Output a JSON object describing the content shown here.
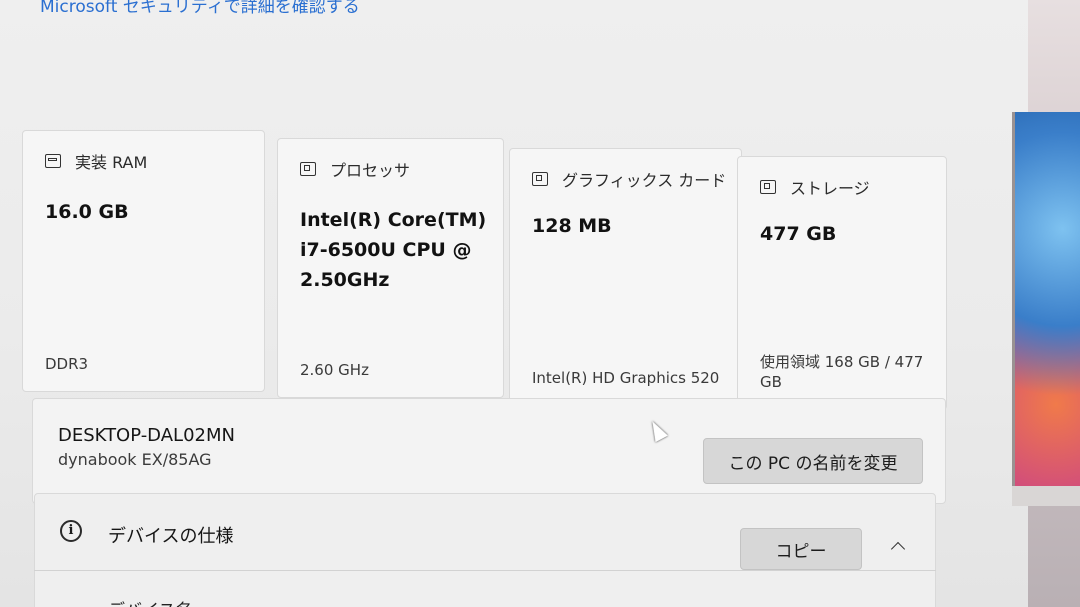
{
  "header": {
    "link_text": "Microsoft セキュリティで詳細を確認する"
  },
  "cards": [
    {
      "id": "ram",
      "title": "実装 RAM",
      "icon": "memory-icon",
      "value": "16.0 GB",
      "sub": "DDR3"
    },
    {
      "id": "cpu",
      "title": "プロセッサ",
      "icon": "processor-icon",
      "value_lines": [
        "Intel(R) Core(TM)",
        "i7-6500U CPU @",
        "2.50GHz"
      ],
      "sub": "2.60 GHz"
    },
    {
      "id": "gpu",
      "title": "グラフィックス カード",
      "icon": "graphics-card-icon",
      "value": "128 MB",
      "sub": "Intel(R) HD Graphics 520"
    },
    {
      "id": "storage",
      "title": "ストレージ",
      "icon": "storage-icon",
      "value": "477 GB",
      "sub_lines": [
        "使用領域 168 GB / 477",
        "GB"
      ]
    }
  ],
  "device": {
    "name": "DESKTOP-DAL02MN",
    "model": "dynabook EX/85AG",
    "rename_button": "この PC の名前を変更"
  },
  "specs": {
    "title": "デバイスの仕様",
    "copy_button": "コピー",
    "partial_row": "デバイス名"
  }
}
